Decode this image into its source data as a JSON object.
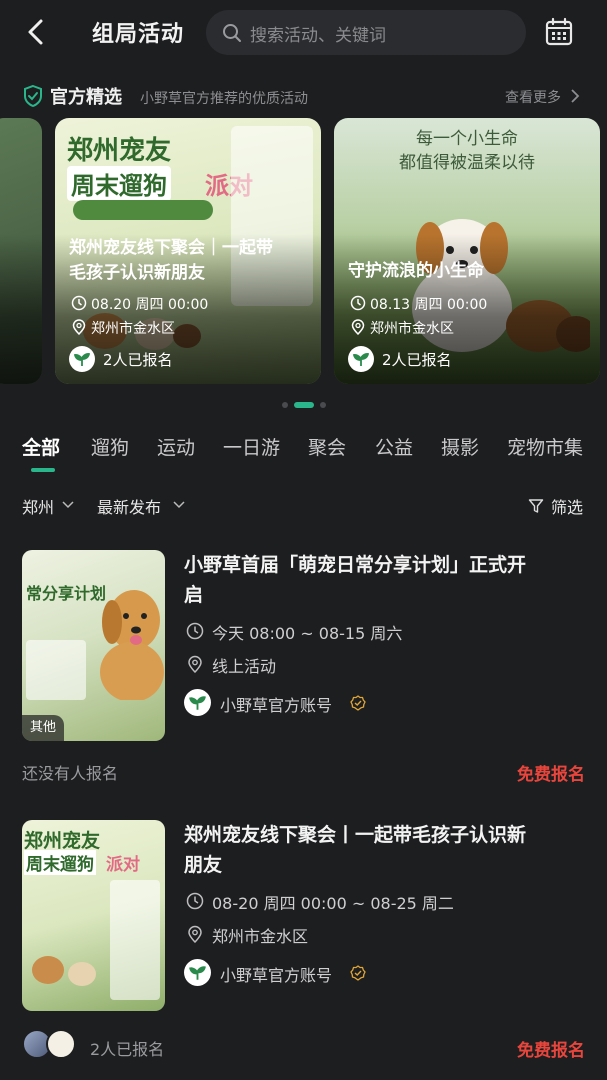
{
  "header": {
    "title": "组局活动",
    "search_placeholder": "搜索活动、关键词"
  },
  "picks": {
    "title": "官方精选",
    "subtitle": "小野草官方推荐的优质活动",
    "more": "查看更多"
  },
  "cards": [
    {
      "title_lines": [
        "郑州宠友线下聚会｜一起带",
        "毛孩子认识新朋友"
      ],
      "date": "08.20 周四 00:00",
      "location": "郑州市金水区",
      "enrolled": "2人已报名",
      "poster": {
        "line1": "郑州宠友",
        "line2": "周末遛狗",
        "line3": "派对"
      }
    },
    {
      "title_lines": [
        "守护流浪的小生命"
      ],
      "date": "08.13 周四 00:00",
      "location": "郑州市金水区",
      "enrolled": "2人已报名",
      "poster": {
        "quote1": "每一个小生命",
        "quote2": "都值得被温柔以待"
      }
    }
  ],
  "carousel": {
    "count": 3,
    "active_index": 1
  },
  "tabs": [
    "全部",
    "遛狗",
    "运动",
    "一日游",
    "聚会",
    "公益",
    "摄影",
    "宠物市集"
  ],
  "active_tab": 0,
  "filters": {
    "city": "郑州",
    "sort": "最新发布",
    "filter": "筛选"
  },
  "list": [
    {
      "title_lines": [
        "小野草首届「萌宠日常分享计划」正式开",
        "启"
      ],
      "time": "今天 08:00 ~ 08-15 周六",
      "location": "线上活动",
      "organizer": "小野草官方账号",
      "badge": "其他",
      "poster": {
        "line1": "常分享计划"
      },
      "signup_info": "还没有人报名",
      "action": "免费报名"
    },
    {
      "title_lines": [
        "郑州宠友线下聚会丨一起带毛孩子认识新",
        "朋友"
      ],
      "time": "08-20 周四 00:00 ~ 08-25 周二",
      "location": "郑州市金水区",
      "organizer": "小野草官方账号",
      "poster": {
        "line1": "郑州宠友",
        "line2": "周末遛狗",
        "line3": "派对"
      },
      "signup_info": "2人已报名",
      "action": "免费报名"
    }
  ],
  "colors": {
    "accent": "#2bb58a",
    "free": "#e8453c",
    "background": "#1d1e20"
  }
}
